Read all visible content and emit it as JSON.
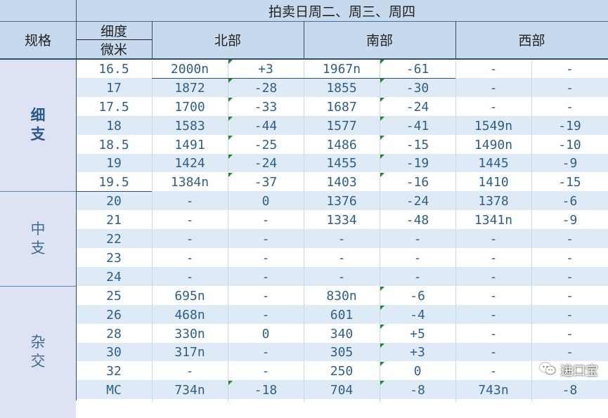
{
  "header": {
    "title": "拍卖日周二、周三、周四",
    "spec_label": "规格",
    "fineness_label_top": "细度",
    "fineness_label_bottom": "微米",
    "regions": [
      "北部",
      "南部",
      "西部"
    ]
  },
  "groups": [
    {
      "id": "fine",
      "label_lines": [
        "细",
        "支"
      ],
      "bold": true,
      "start": 0,
      "count": 7
    },
    {
      "id": "medium",
      "label_lines": [
        "中",
        "支"
      ],
      "bold": false,
      "start": 7,
      "count": 5
    },
    {
      "id": "cross",
      "label_lines": [
        "杂",
        "交"
      ],
      "bold": false,
      "start": 12,
      "count": 7
    }
  ],
  "rows": [
    {
      "micron": "16.5",
      "north": "2000n",
      "north_chg": "+3",
      "south": "1967n",
      "south_chg": "-61",
      "west": "-",
      "west_chg": "-"
    },
    {
      "micron": "17",
      "north": "1872",
      "north_chg": "-28",
      "south": "1855",
      "south_chg": "-30",
      "west": "-",
      "west_chg": "-"
    },
    {
      "micron": "17.5",
      "north": "1700",
      "north_chg": "-33",
      "south": "1687",
      "south_chg": "-24",
      "west": "-",
      "west_chg": "-"
    },
    {
      "micron": "18",
      "north": "1583",
      "north_chg": "-44",
      "south": "1577",
      "south_chg": "-41",
      "west": "1549n",
      "west_chg": "-19"
    },
    {
      "micron": "18.5",
      "north": "1491",
      "north_chg": "-25",
      "south": "1486",
      "south_chg": "-15",
      "west": "1490n",
      "west_chg": "-10"
    },
    {
      "micron": "19",
      "north": "1424",
      "north_chg": "-24",
      "south": "1455",
      "south_chg": "-19",
      "west": "1445",
      "west_chg": "-9"
    },
    {
      "micron": "19.5",
      "north": "1384n",
      "north_chg": "-37",
      "south": "1403",
      "south_chg": "-16",
      "west": "1410",
      "west_chg": "-15"
    },
    {
      "micron": "20",
      "north": "-",
      "north_chg": "0",
      "south": "1376",
      "south_chg": "-24",
      "west": "1378",
      "west_chg": "-6"
    },
    {
      "micron": "21",
      "north": "-",
      "north_chg": "-",
      "south": "1334",
      "south_chg": "-48",
      "west": "1341n",
      "west_chg": "-9"
    },
    {
      "micron": "22",
      "north": "-",
      "north_chg": "-",
      "south": "-",
      "south_chg": "-",
      "west": "-",
      "west_chg": "-"
    },
    {
      "micron": "23",
      "north": "-",
      "north_chg": "-",
      "south": "-",
      "south_chg": "-",
      "west": "-",
      "west_chg": "-"
    },
    {
      "micron": "24",
      "north": "-",
      "north_chg": "-",
      "south": "-",
      "south_chg": "-",
      "west": "-",
      "west_chg": "-"
    },
    {
      "micron": "25",
      "north": "695n",
      "north_chg": "-",
      "south": "830n",
      "south_chg": "-6",
      "west": "-",
      "west_chg": "-"
    },
    {
      "micron": "26",
      "north": "468n",
      "north_chg": "-",
      "south": "601",
      "south_chg": "-4",
      "west": "-",
      "west_chg": "-"
    },
    {
      "micron": "28",
      "north": "330n",
      "north_chg": "0",
      "south": "340",
      "south_chg": "+5",
      "west": "-",
      "west_chg": "-"
    },
    {
      "micron": "30",
      "north": "317n",
      "north_chg": "-",
      "south": "305",
      "south_chg": "+3",
      "west": "-",
      "west_chg": "-"
    },
    {
      "micron": "32",
      "north": "-",
      "north_chg": "-",
      "south": "250",
      "south_chg": "0",
      "west": "-",
      "west_chg": "-"
    },
    {
      "micron": "MC",
      "north": "734n",
      "north_chg": "-18",
      "south": "704",
      "south_chg": "-8",
      "west": "743n",
      "west_chg": "-8"
    }
  ],
  "flag_rows_north": [
    0,
    1,
    2,
    3,
    4,
    5,
    6,
    17
  ],
  "flag_rows_south": [
    0,
    1,
    2,
    3,
    4,
    5,
    6,
    12,
    13,
    14,
    15,
    16,
    17
  ],
  "watermark": {
    "text": "进口宝",
    "icon": "wechat-icon"
  },
  "colors": {
    "header_bg": "#c7d9ec",
    "group_bg": "#dde3f3",
    "row_alt_bg": "#deeaf6",
    "row_bg": "#ffffff",
    "text": "#2f5f8a",
    "flag": "#1e8a2e"
  }
}
